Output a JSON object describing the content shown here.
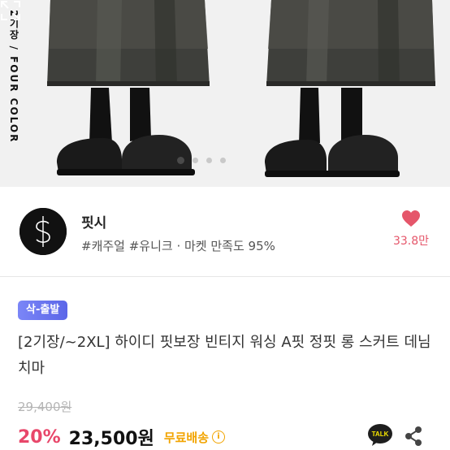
{
  "hero": {
    "side_label": "2기장 / FOUR COLOR",
    "carousel_dots": 4,
    "active_dot": 0
  },
  "seller": {
    "name": "핏시",
    "tags": "#캐주얼 #유니크 · 마켓 만족도 95%",
    "like_count": "33.8만"
  },
  "product": {
    "badge": "삭-출발",
    "title": "[2기장/~2XL] 하이디 핏보장 빈티지 워싱 A핏 정핏 롱 스커트 데님 치마",
    "original_price": "29,400원",
    "discount": "20%",
    "price": "23,500원",
    "shipping": "무료배송"
  },
  "actions": {
    "talk_label": "TALK"
  },
  "colors": {
    "accent_pink": "#e8476a",
    "heart": "#e5566a",
    "badge": "#6b76f0",
    "shipping": "#f2a400"
  }
}
